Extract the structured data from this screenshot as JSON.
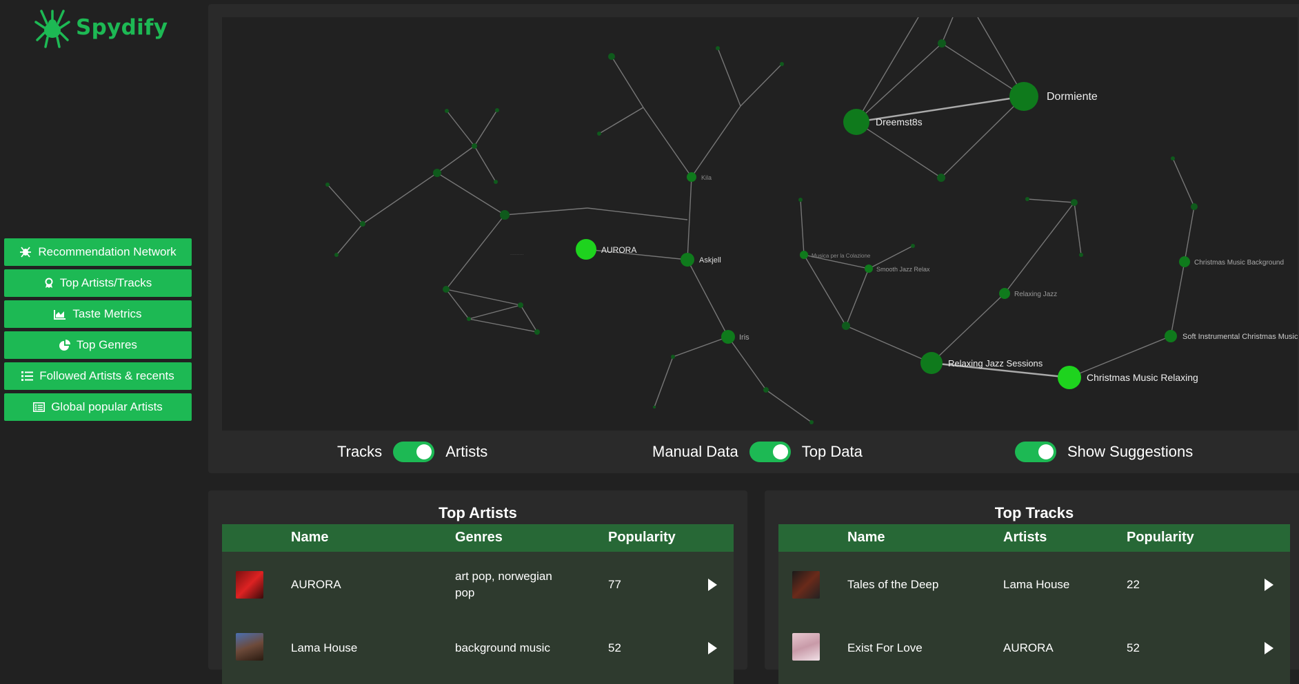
{
  "app": {
    "name": "Spydify",
    "brand_color": "#1db954"
  },
  "sidebar": {
    "items": [
      {
        "label": "Recommendation Network",
        "icon": "spider-icon"
      },
      {
        "label": "Top Artists/Tracks",
        "icon": "award-icon"
      },
      {
        "label": "Taste Metrics",
        "icon": "area-chart-icon"
      },
      {
        "label": "Top Genres",
        "icon": "pie-chart-icon"
      },
      {
        "label": "Followed Artists & recents",
        "icon": "list-icon"
      },
      {
        "label": "Global popular Artists",
        "icon": "table-list-icon"
      }
    ]
  },
  "graph": {
    "nodes": [
      {
        "label": "AURORA",
        "tier": "main"
      },
      {
        "label": "Askjell",
        "tier": "mid"
      },
      {
        "label": "Iris",
        "tier": "mid"
      },
      {
        "label": "Kila",
        "tier": "mid"
      },
      {
        "label": "Dreemst8s",
        "tier": "big"
      },
      {
        "label": "Dormiente",
        "tier": "big"
      },
      {
        "label": "Relaxing Jazz Sessions",
        "tier": "big"
      },
      {
        "label": "Christmas Music Relaxing",
        "tier": "main"
      },
      {
        "label": "Soft Instrumental Christmas Music",
        "tier": "mid"
      },
      {
        "label": "Christmas Music Background",
        "tier": "mid"
      },
      {
        "label": "Relaxing Jazz",
        "tier": "mid"
      },
      {
        "label": "Smooth Jazz Relax",
        "tier": "mid"
      },
      {
        "label": "Musica per la Colazione",
        "tier": "mid"
      }
    ]
  },
  "toggles": {
    "group1": {
      "left": "Tracks",
      "right": "Artists",
      "on": true
    },
    "group2": {
      "left": "Manual Data",
      "right": "Top Data",
      "on": true
    },
    "group3": {
      "right": "Show Suggestions",
      "on": true
    }
  },
  "top_artists": {
    "title": "Top Artists",
    "columns": [
      "Name",
      "Genres",
      "Popularity"
    ],
    "rows": [
      {
        "name": "AURORA",
        "genres_line1": "art pop, norwegian",
        "genres_line2": "pop",
        "popularity": "77"
      },
      {
        "name": "Lama House",
        "genres_line1": "background music",
        "genres_line2": "",
        "popularity": "52"
      }
    ]
  },
  "top_tracks": {
    "title": "Top Tracks",
    "columns": [
      "Name",
      "Artists",
      "Popularity"
    ],
    "rows": [
      {
        "name": "Tales of the Deep",
        "artist": "Lama House",
        "popularity": "22"
      },
      {
        "name": "Exist For Love",
        "artist": "AURORA",
        "popularity": "52"
      }
    ]
  }
}
